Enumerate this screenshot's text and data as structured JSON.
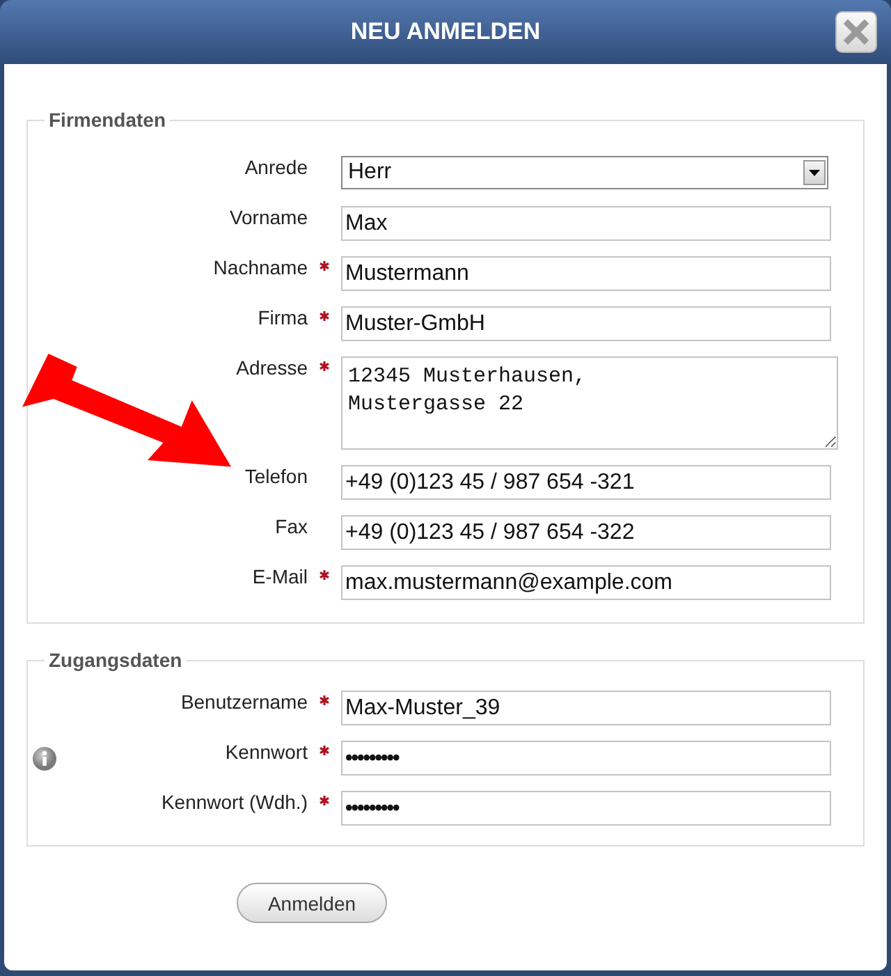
{
  "window": {
    "title": "NEU ANMELDEN"
  },
  "sections": [
    {
      "legend": "Firmendaten",
      "rows": [
        {
          "label": "Anrede",
          "required": false,
          "kind": "select",
          "value": "Herr"
        },
        {
          "label": "Vorname",
          "required": false,
          "kind": "text",
          "value": "Max"
        },
        {
          "label": "Nachname",
          "required": true,
          "kind": "text",
          "value": "Mustermann"
        },
        {
          "label": "Firma",
          "required": true,
          "kind": "text",
          "value": "Muster-GmbH"
        },
        {
          "label": "Adresse",
          "required": true,
          "kind": "textarea",
          "value": "12345 Musterhausen,\nMustergasse 22"
        },
        {
          "label": "Telefon",
          "required": false,
          "kind": "text",
          "value": "+49 (0)123 45 / 987 654 -321"
        },
        {
          "label": "Fax",
          "required": false,
          "kind": "text",
          "value": "+49 (0)123 45 / 987 654 -322"
        },
        {
          "label": "E-Mail",
          "required": true,
          "kind": "text",
          "value": "max.mustermann@example.com"
        }
      ]
    },
    {
      "legend": "Zugangsdaten",
      "rows": [
        {
          "label": "Benutzername",
          "required": true,
          "kind": "text",
          "value": "Max-Muster_39"
        },
        {
          "label": "Kennwort",
          "required": true,
          "kind": "password",
          "value": "•••••••••",
          "info": true
        },
        {
          "label": "Kennwort (Wdh.)",
          "required": true,
          "kind": "password",
          "value": "•••••••••"
        }
      ]
    }
  ],
  "submit": "Anmelden"
}
